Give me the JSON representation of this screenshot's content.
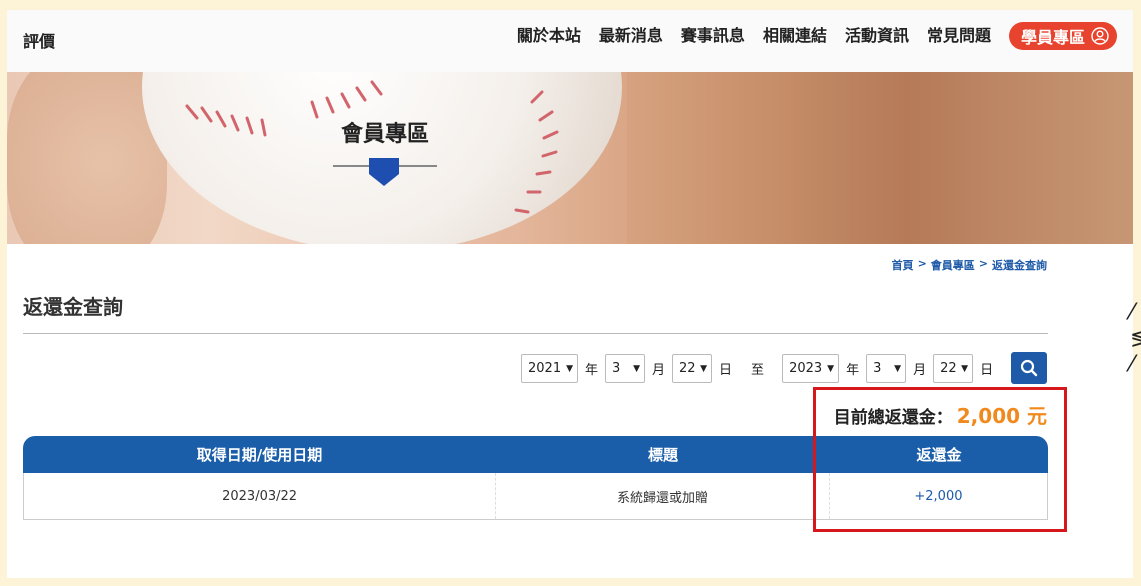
{
  "nav": {
    "site_name": "評價",
    "links": [
      "關於本站",
      "最新消息",
      "賽事訊息",
      "相關連結",
      "活動資訊",
      "常見問題"
    ],
    "member_label": "學員專區",
    "member_icon": "user-circle-icon"
  },
  "hero": {
    "title": "會員專區"
  },
  "breadcrumb": {
    "items": [
      "首頁",
      "會員專區",
      "返還金查詢"
    ],
    "separator": ">"
  },
  "page_title": "返還金查詢",
  "filter": {
    "start_year": "2021",
    "start_month": "3",
    "start_day": "22",
    "end_year": "2023",
    "end_month": "3",
    "end_day": "22",
    "year_unit": "年",
    "month_unit": "月",
    "day_unit": "日",
    "to_label": "至",
    "search_icon": "search-icon"
  },
  "total": {
    "label": "目前總返還金：",
    "amount": "2,000 元"
  },
  "table": {
    "headers": [
      "取得日期/使用日期",
      "標題",
      "返還金"
    ],
    "rows": [
      {
        "date": "2023/03/22",
        "title": "系統歸還或加贈",
        "amount": "+2,000"
      }
    ]
  },
  "colors": {
    "primary_blue": "#1a5da9",
    "member_red": "#e8432f",
    "total_orange": "#f08a1e",
    "highlight_red": "#d6171c",
    "background": "#fdf3d6"
  }
}
